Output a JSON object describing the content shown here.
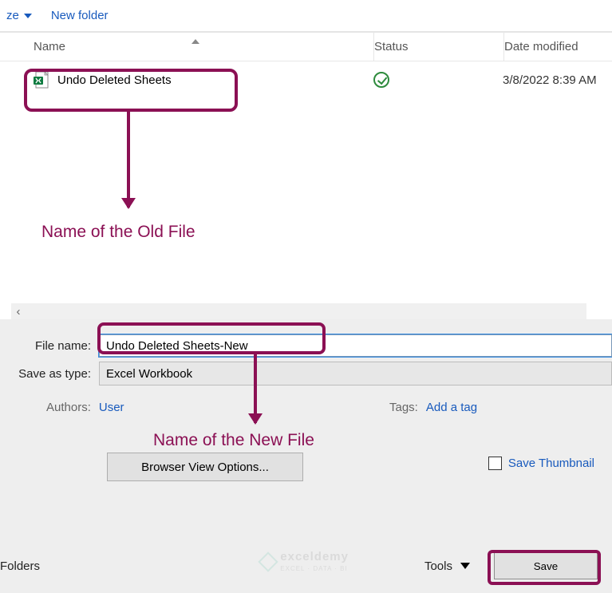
{
  "toolbar": {
    "organize_label": "ze",
    "new_folder_label": "New folder"
  },
  "columns": {
    "name": "Name",
    "status": "Status",
    "date": "Date modified"
  },
  "files": [
    {
      "name": "Undo Deleted Sheets",
      "date": "3/8/2022 8:39 AM"
    }
  ],
  "annotations": {
    "old_file": "Name of the Old File",
    "new_file": "Name of the New File"
  },
  "form": {
    "file_name_label": "File name:",
    "file_name_value": "Undo Deleted Sheets-New",
    "save_type_label": "Save as type:",
    "save_type_value": "Excel Workbook",
    "authors_label": "Authors:",
    "authors_value": "User",
    "tags_label": "Tags:",
    "tags_value": "Add a tag",
    "browser_view_label": "Browser View Options...",
    "save_thumb_label": "Save Thumbnail"
  },
  "bottom": {
    "folders_label": "Folders",
    "tools_label": "Tools",
    "save_label": "Save"
  },
  "watermark": {
    "brand": "exceldemy",
    "tagline": "EXCEL · DATA · BI"
  }
}
